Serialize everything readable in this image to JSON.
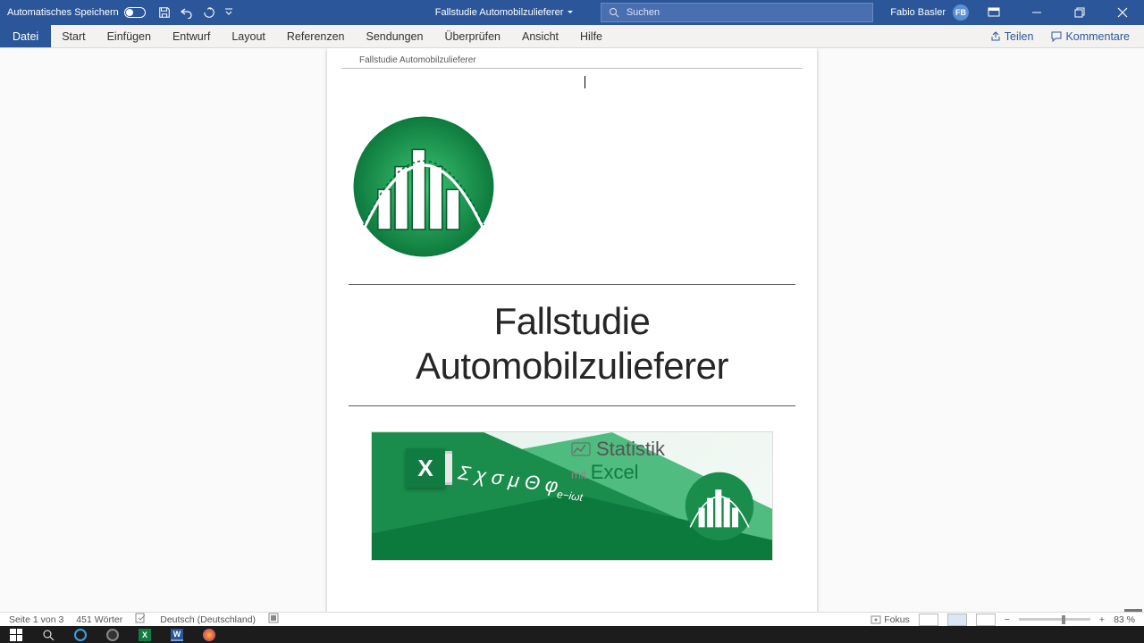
{
  "titlebar": {
    "autosave_label": "Automatisches Speichern",
    "doc_name": "Fallstudie Automobilzulieferer",
    "search_placeholder": "Suchen",
    "user_name": "Fabio Basler",
    "user_initials": "FB"
  },
  "ribbon": {
    "tabs": [
      "Datei",
      "Start",
      "Einfügen",
      "Entwurf",
      "Layout",
      "Referenzen",
      "Sendungen",
      "Überprüfen",
      "Ansicht",
      "Hilfe"
    ],
    "share": "Teilen",
    "comments": "Kommentare"
  },
  "document": {
    "running_header": "Fallstudie Automobilzulieferer",
    "title_line1": "Fallstudie",
    "title_line2": "Automobilzulieferer",
    "banner_title1": "Statistik",
    "banner_mit": "mit",
    "banner_excel": "Excel",
    "banner_x": "X",
    "banner_greek": "Σ χ σ μ Θ φ",
    "banner_greek_sub": "e−iωt"
  },
  "statusbar": {
    "page": "Seite 1 von 3",
    "words": "451 Wörter",
    "language": "Deutsch (Deutschland)",
    "fokus": "Fokus",
    "zoom": "83 %",
    "zoom_minus": "−",
    "zoom_plus": "+"
  }
}
